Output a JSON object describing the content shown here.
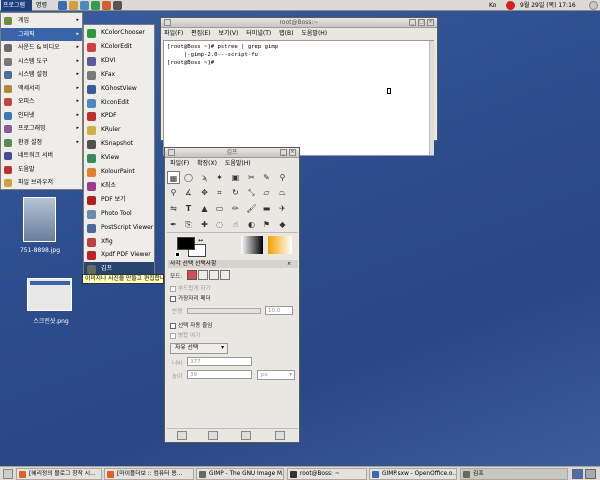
{
  "top_panel": {
    "menus": [
      "프로그램",
      "명령"
    ],
    "keyboard": "Ko",
    "clock": "9월 29일 (목) 17:16"
  },
  "main_menu": {
    "items": [
      {
        "label": "게임",
        "icon": "game-icon",
        "color": "#6b8e3a",
        "arrow": true
      },
      {
        "label": "그래픽",
        "icon": "graphics-icon",
        "color": "#3a63a8",
        "arrow": true,
        "selected": true
      },
      {
        "label": "사운드 & 비디오",
        "icon": "sound-icon",
        "color": "#6a6a6a",
        "arrow": true
      },
      {
        "label": "시스템 도구",
        "icon": "system-tools-icon",
        "color": "#7a7a7a",
        "arrow": true
      },
      {
        "label": "시스템 설정",
        "icon": "system-settings-icon",
        "color": "#4a6f9a",
        "arrow": true
      },
      {
        "label": "액세서리",
        "icon": "accessories-icon",
        "color": "#b08a3c",
        "arrow": true
      },
      {
        "label": "오피스",
        "icon": "office-icon",
        "color": "#c0473a",
        "arrow": true
      },
      {
        "label": "인터넷",
        "icon": "internet-icon",
        "color": "#3a7ab0",
        "arrow": true
      },
      {
        "label": "프로그래밍",
        "icon": "programming-icon",
        "color": "#8a5aa0",
        "arrow": true
      },
      {
        "label": "환경 설정",
        "icon": "preferences-icon",
        "color": "#5a8a5a",
        "arrow": true
      },
      {
        "label": "네트워크 서버",
        "icon": "network-server-icon",
        "color": "#4a4a9a",
        "arrow": false
      },
      {
        "label": "도움말",
        "icon": "help-icon",
        "color": "#c03030",
        "arrow": false
      },
      {
        "label": "파일 브라우저",
        "icon": "file-browser-icon",
        "color": "#d0a040",
        "arrow": false
      }
    ]
  },
  "graphics_submenu": {
    "items": [
      {
        "label": "KColorChooser",
        "icon": "kcolorchooser-icon",
        "color": "#2a9a3a"
      },
      {
        "label": "KColorEdit",
        "icon": "kcoloredit-icon",
        "color": "#d04040"
      },
      {
        "label": "KDVI",
        "icon": "kdvi-icon",
        "color": "#5a5a9a"
      },
      {
        "label": "KFax",
        "icon": "kfax-icon",
        "color": "#7a7a7a"
      },
      {
        "label": "KGhostView",
        "icon": "kghostview-icon",
        "color": "#3a5a9a"
      },
      {
        "label": "KIconEdit",
        "icon": "kiconedit-icon",
        "color": "#4a8ac0"
      },
      {
        "label": "KPDF",
        "icon": "kpdf-icon",
        "color": "#c03030"
      },
      {
        "label": "KRuler",
        "icon": "kruler-icon",
        "color": "#d0b040"
      },
      {
        "label": "KSnapshot",
        "icon": "ksnapshot-icon",
        "color": "#505050"
      },
      {
        "label": "KView",
        "icon": "kview-icon",
        "color": "#3a8a5a"
      },
      {
        "label": "KolourPaint",
        "icon": "kolourpaint-icon",
        "color": "#e08030"
      },
      {
        "label": "K죄소",
        "icon": "kmag-icon",
        "color": "#a03a8a"
      },
      {
        "label": "PDF 보기",
        "icon": "pdf-viewer-icon",
        "color": "#b02020"
      },
      {
        "label": "Photo Tool",
        "icon": "photo-tool-icon",
        "color": "#6a8ab0"
      },
      {
        "label": "PostScript Viewer",
        "icon": "postscript-viewer-icon",
        "color": "#4a6a9a"
      },
      {
        "label": "Xfig",
        "icon": "xfig-icon",
        "color": "#c04040"
      },
      {
        "label": "Xpdf PDF Viewer",
        "icon": "xpdf-icon",
        "color": "#c02020"
      },
      {
        "label": "김프",
        "icon": "gimp-icon",
        "color": "#6a6a5a",
        "selected": true
      }
    ]
  },
  "tooltip": "이미지나 사진을 만들고 편집합니다",
  "terminal": {
    "title": "root@Boss:~",
    "menus": [
      "파일(F)",
      "편집(E)",
      "보기(V)",
      "터미널(T)",
      "탭(B)",
      "도움말(H)"
    ],
    "lines": [
      "[root@Boss ~]# pstree | grep gimp",
      "     |-gimp-2.0---script-fu",
      "[root@Boss ~]# "
    ]
  },
  "gimp": {
    "title": "김프",
    "menus": [
      "파일(F)",
      "확장(X)",
      "도움말(H)"
    ],
    "options_title": "사각 선택 선택사항",
    "mode_label": "모드:",
    "feather": "부드럽게 하기",
    "antialias": "가장자리 페더",
    "radius_label": "반경",
    "radius_value": "10.0",
    "auto_shrink": "선택 자동 줄임",
    "merged": "병합 여기",
    "fixed_label": "자유 선택",
    "width_label": "너비",
    "width_value": "377",
    "height_label": "높이",
    "height_value": "39",
    "unit": "px"
  },
  "desktop_icons": [
    {
      "label": "751-8898.jpg"
    },
    {
      "label": "스크린샷.png"
    }
  ],
  "taskbar": {
    "tasks": [
      {
        "label": "[혜리정의 블로그 창작 시...",
        "color": "#e06020",
        "active": false
      },
      {
        "label": "[마이플더보 :: 컴퓨터 용...",
        "color": "#e06020",
        "active": false
      },
      {
        "label": "GIMP - The GNU Image M...",
        "color": "#6a6a5a",
        "active": false
      },
      {
        "label": "root@Boss: ~",
        "color": "#333333",
        "active": false
      },
      {
        "label": "GIMP.sxw - OpenOffice.o...",
        "color": "#3a6ab0",
        "active": false
      },
      {
        "label": "김프",
        "color": "#6a6a5a",
        "active": true
      }
    ]
  }
}
